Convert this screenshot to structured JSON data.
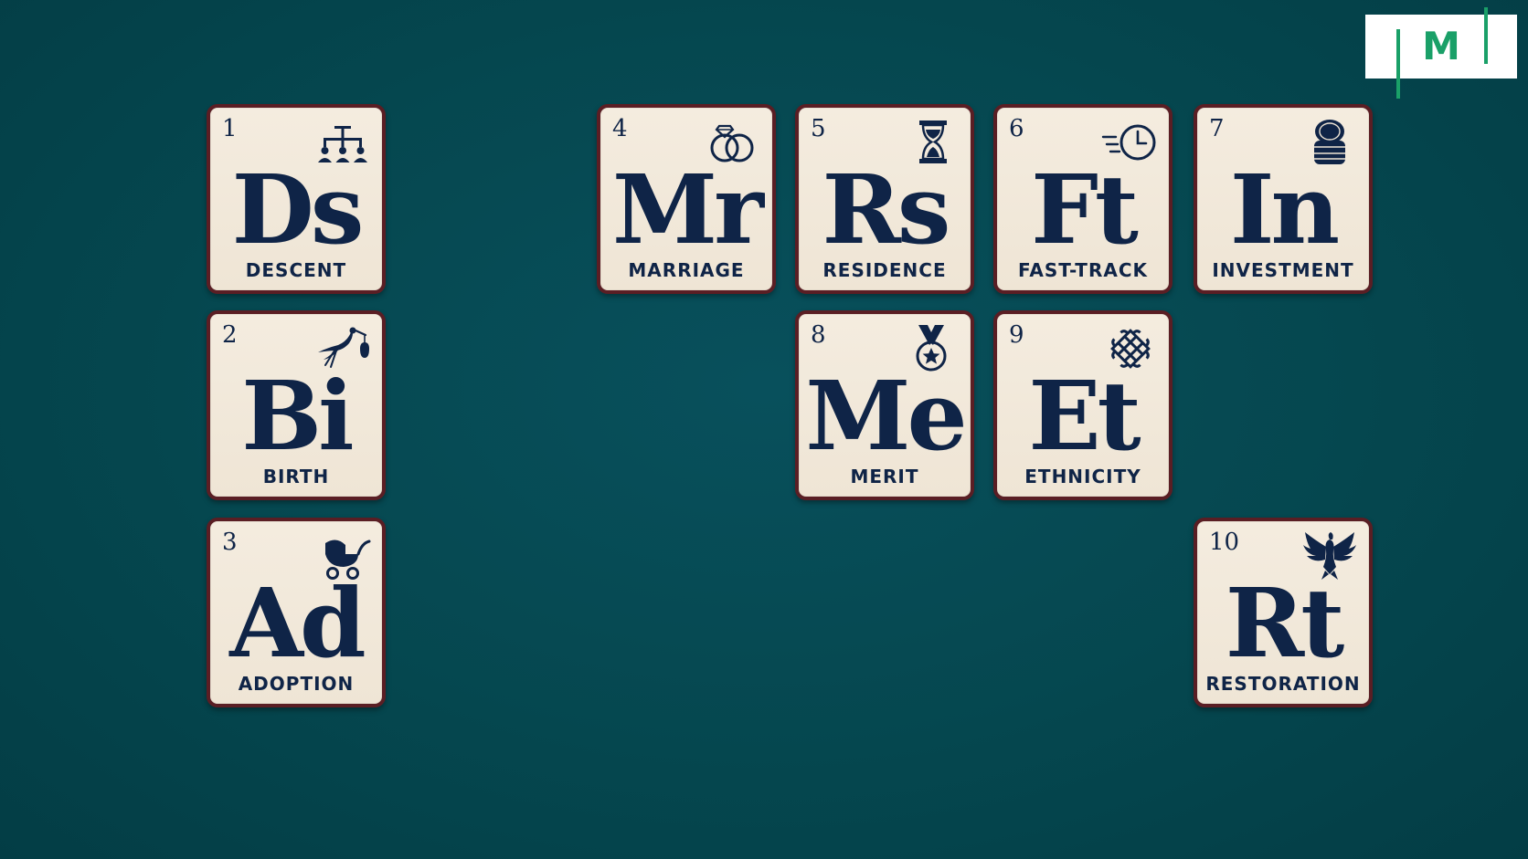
{
  "logo": {
    "letter": "M",
    "color": "#1aa068"
  },
  "colors": {
    "background": "#044750",
    "tile_fill": "#f2e9db",
    "tile_border": "#5a1e24",
    "ink": "#0f2447"
  },
  "tiles": [
    {
      "number": "1",
      "symbol": "Ds",
      "label": "DESCENT",
      "icon": "family-tree-icon"
    },
    {
      "number": "2",
      "symbol": "Bi",
      "label": "BIRTH",
      "icon": "stork-icon"
    },
    {
      "number": "3",
      "symbol": "Ad",
      "label": "ADOPTION",
      "icon": "baby-carriage-icon"
    },
    {
      "number": "4",
      "symbol": "Mr",
      "label": "MARRIAGE",
      "icon": "wedding-rings-icon"
    },
    {
      "number": "5",
      "symbol": "Rs",
      "label": "RESIDENCE",
      "icon": "hourglass-icon"
    },
    {
      "number": "6",
      "symbol": "Ft",
      "label": "FAST-TRACK",
      "icon": "fast-clock-icon"
    },
    {
      "number": "7",
      "symbol": "In",
      "label": "INVESTMENT",
      "icon": "coin-stack-icon"
    },
    {
      "number": "8",
      "symbol": "Me",
      "label": "MERIT",
      "icon": "medal-icon"
    },
    {
      "number": "9",
      "symbol": "Et",
      "label": "ETHNICITY",
      "icon": "endless-knot-icon"
    },
    {
      "number": "10",
      "symbol": "Rt",
      "label": "RESTORATION",
      "icon": "phoenix-icon"
    }
  ]
}
